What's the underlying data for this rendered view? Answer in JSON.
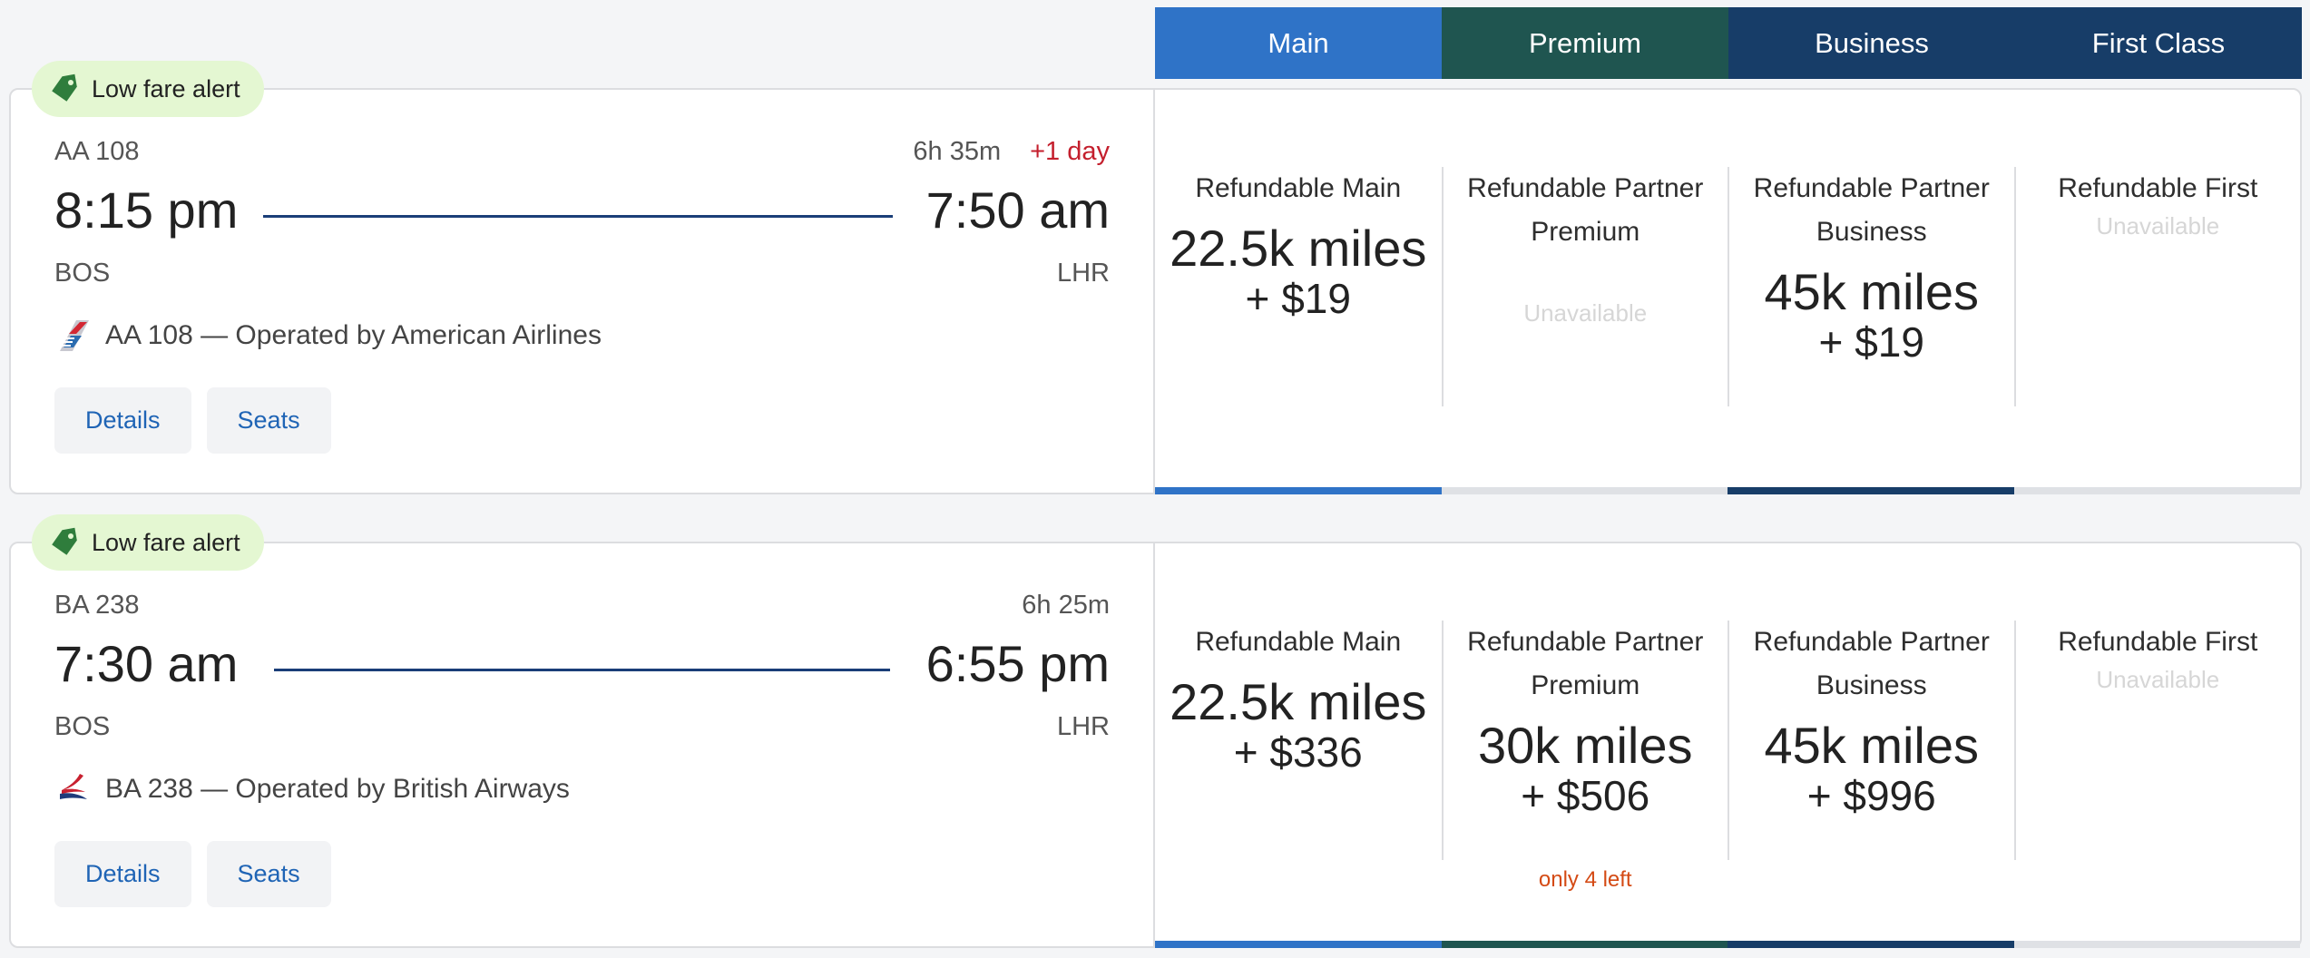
{
  "colors": {
    "main": "#2f73c7",
    "premium": "#1f5550",
    "business": "#173d68",
    "first": "#173d68",
    "bar_empty": "#dfe1e5"
  },
  "cabins": [
    {
      "label": "Main"
    },
    {
      "label": "Premium"
    },
    {
      "label": "Business"
    },
    {
      "label": "First Class"
    }
  ],
  "flights": [
    {
      "badge": "Low fare alert",
      "flight_number": "AA 108",
      "duration": "6h 35m",
      "plus_day": "+1 day",
      "depart_time": "8:15 pm",
      "arrive_time": "7:50 am",
      "depart_airport": "BOS",
      "arrive_airport": "LHR",
      "operated_by": "AA 108 — Operated by American Airlines",
      "airline_logo_icon": "american-airlines-logo-icon",
      "details_label": "Details",
      "seats_label": "Seats",
      "fares": [
        {
          "name": "Refundable Main",
          "miles": "22.5k miles",
          "fee": "+ $19",
          "bar": "main"
        },
        {
          "name": "Refundable Partner Premium",
          "unavailable": "Unavailable",
          "bar": "empty"
        },
        {
          "name": "Refundable Partner Business",
          "miles": "45k miles",
          "fee": "+ $19",
          "bar": "business"
        },
        {
          "name": "Refundable First",
          "unavailable": "Unavailable",
          "bar": "empty"
        }
      ]
    },
    {
      "badge": "Low fare alert",
      "flight_number": "BA 238",
      "duration": "6h 25m",
      "depart_time": "7:30 am",
      "arrive_time": "6:55 pm",
      "depart_airport": "BOS",
      "arrive_airport": "LHR",
      "operated_by": "BA 238 — Operated by British Airways",
      "airline_logo_icon": "british-airways-logo-icon",
      "details_label": "Details",
      "seats_label": "Seats",
      "fares": [
        {
          "name": "Refundable Main",
          "miles": "22.5k miles",
          "fee": "+ $336",
          "bar": "main"
        },
        {
          "name": "Refundable Partner Premium",
          "miles": "30k miles",
          "fee": "+ $506",
          "note": "only 4 left",
          "bar": "premium"
        },
        {
          "name": "Refundable Partner Business",
          "miles": "45k miles",
          "fee": "+ $996",
          "bar": "business"
        },
        {
          "name": "Refundable First",
          "unavailable": "Unavailable",
          "bar": "empty"
        }
      ]
    }
  ]
}
